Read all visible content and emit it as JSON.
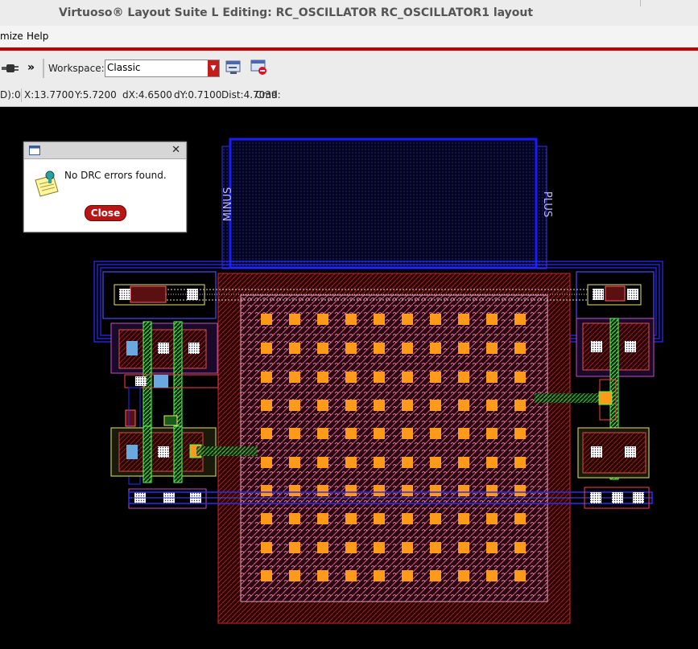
{
  "window": {
    "title": "Virtuoso® Layout Suite L Editing: RC_OSCILLATOR RC_OSCILLATOR1 layout"
  },
  "menubar": {
    "items": [
      "mize",
      "Help"
    ]
  },
  "toolbar": {
    "overflow": "»",
    "workspace_label": "Workspace:",
    "workspace_value": "Classic"
  },
  "status": {
    "left": "D):0",
    "x": "X:13.7700",
    "y": "Y:5.7200",
    "dx": "dX:4.6500",
    "dy": "dY:0.7100",
    "dist": "Dist:4.7039",
    "cmd": "Cmd:"
  },
  "dialog": {
    "message": "No DRC errors found.",
    "close_label": "Close"
  },
  "layout": {
    "pin_minus": "MINUS",
    "pin_plus": "PLUS"
  },
  "colors": {
    "accent_red": "#c40000",
    "metal_blue": "#2233ff",
    "poly_red": "#cc2222",
    "contact_orange": "#ff9a1a",
    "diff_green": "#33cc33"
  }
}
